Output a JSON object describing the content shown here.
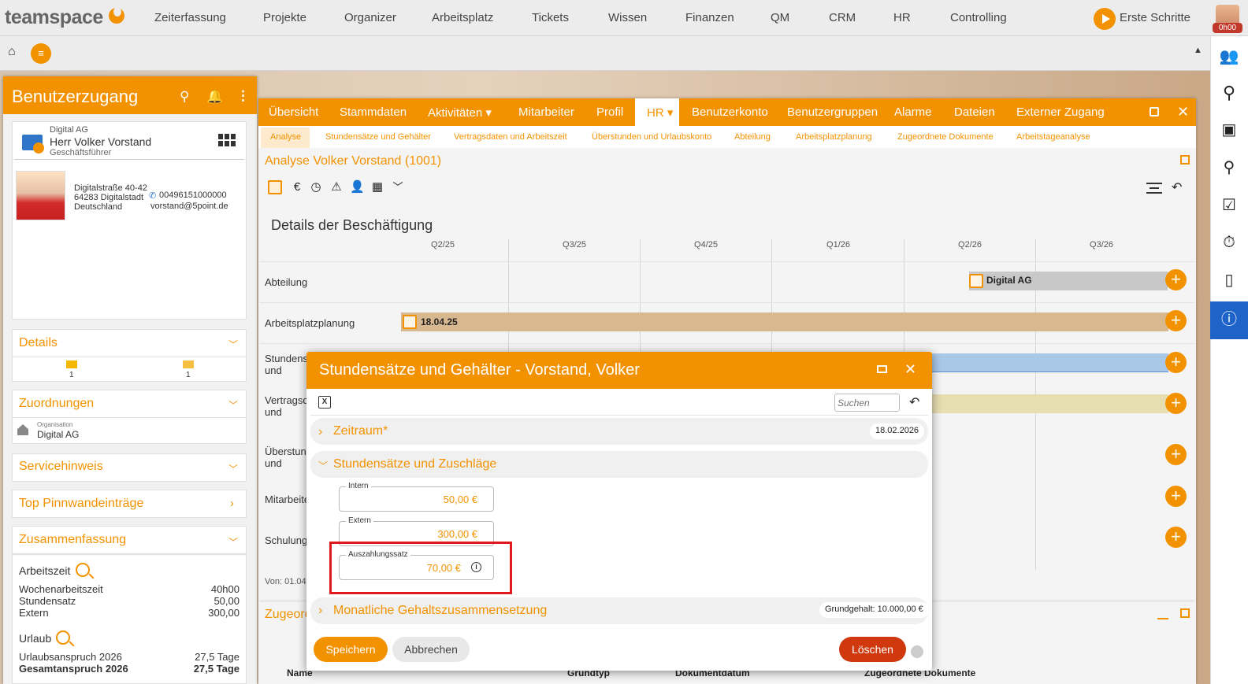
{
  "topnav": {
    "logo": "teamspace",
    "items": [
      "Zeiterfassung",
      "Projekte",
      "Organizer",
      "Arbeitsplatz",
      "Tickets",
      "Wissen",
      "Finanzen",
      "QM",
      "CRM",
      "HR",
      "Controlling"
    ],
    "start_label": "Erste Schritte",
    "timer_badge": "0h00",
    "accent": "#f39200"
  },
  "sidebar": {
    "icons": [
      "users-icon",
      "search-icon",
      "briefcase-icon",
      "pin-icon",
      "checklist-icon",
      "stopwatch-icon",
      "mobile-icon",
      "info-icon"
    ],
    "active": "info-icon",
    "active_color": "#1e64c8"
  },
  "left_panel": {
    "title": "Benutzerzugang",
    "contact": {
      "company": "Digital AG",
      "name": "Herr Volker Vorstand",
      "role": "Geschäftsführer",
      "address": [
        "Digitalstraße 40-42",
        "64283 Digitalstadt",
        "Deutschland"
      ],
      "phone": "00496151000000",
      "email": "vorstand@5point.de"
    },
    "sections": {
      "details": "Details",
      "details_counts": [
        "1",
        "1"
      ],
      "zuordnungen": "Zuordnungen",
      "org_label": "Organisation",
      "org_value": "Digital AG",
      "servicehinweis": "Servicehinweis",
      "pinnwand": "Top Pinnwandeinträge",
      "zusammenfassung": "Zusammenfassung"
    },
    "summary": {
      "arbeitszeit": "Arbeitszeit",
      "rows1": [
        {
          "label": "Wochenarbeitszeit",
          "value": "40h00"
        },
        {
          "label": "Stundensatz",
          "value": "50,00"
        },
        {
          "label": "Extern",
          "value": "300,00"
        }
      ],
      "urlaub": "Urlaub",
      "rows2": [
        {
          "label": "Urlaubsanspruch 2026",
          "value": "27,5 Tage"
        },
        {
          "label": "Gesamtanspruch 2026",
          "value": "27,5 Tage"
        }
      ]
    }
  },
  "main": {
    "tabs": [
      "Übersicht",
      "Stammdaten",
      "Aktivitäten ▾",
      "Mitarbeiter",
      "Profil",
      "HR ▾",
      "Benutzerkonto",
      "Benutzergruppen",
      "Alarme",
      "Dateien",
      "Externer Zugang"
    ],
    "active_tab": "HR ▾",
    "subtabs": [
      "Analyse",
      "Stundensätze und Gehälter",
      "Vertragsdaten und Arbeitszeit",
      "Überstunden und Urlaubskonto",
      "Abteilung",
      "Arbeitsplatzplanung",
      "Zugeordnete Dokumente",
      "Arbeitstageanalyse"
    ],
    "analyse_title": "Analyse Volker Vorstand (1001)",
    "details_title": "Details der Beschäftigung",
    "quarters": [
      "Q2/25",
      "Q3/25",
      "Q4/25",
      "Q1/26",
      "Q2/26",
      "Q3/26"
    ],
    "rows": [
      "Abteilung",
      "Arbeitsplatzplanung",
      "Stundensätze und Gehälter",
      "Vertragsdaten und Arbeitszeit",
      "Überstunden und Urlaubskonto",
      "Mitarbeiter",
      "Schulung"
    ],
    "bar_abteilung": "Digital AG",
    "bar_arbeitsplatz": "18.04.25",
    "von": "Von: 01.04",
    "zugeordnete": "Zugeordnete Dokumente",
    "columns": [
      "Name",
      "Grundtyp",
      "Dokumentdatum",
      "Zugeordnete Dokumente"
    ]
  },
  "dialog": {
    "title": "Stundensätze und Gehälter - Vorstand, Volker",
    "search_placeholder": "Suchen",
    "zeitraum_label": "Zeitraum*",
    "zeitraum_value": "18.02.2026",
    "section_rates": "Stundensätze und Zuschläge",
    "fields": [
      {
        "label": "Intern",
        "value": "50,00 €"
      },
      {
        "label": "Extern",
        "value": "300,00 €"
      },
      {
        "label": "Auszahlungssatz",
        "value": "70,00 €"
      }
    ],
    "section_monthly": "Monatliche Gehaltszusammensetzung",
    "grundgehalt": "Grundgehalt: 10.000,00 €",
    "save": "Speichern",
    "cancel": "Abbrechen",
    "delete": "Löschen"
  }
}
